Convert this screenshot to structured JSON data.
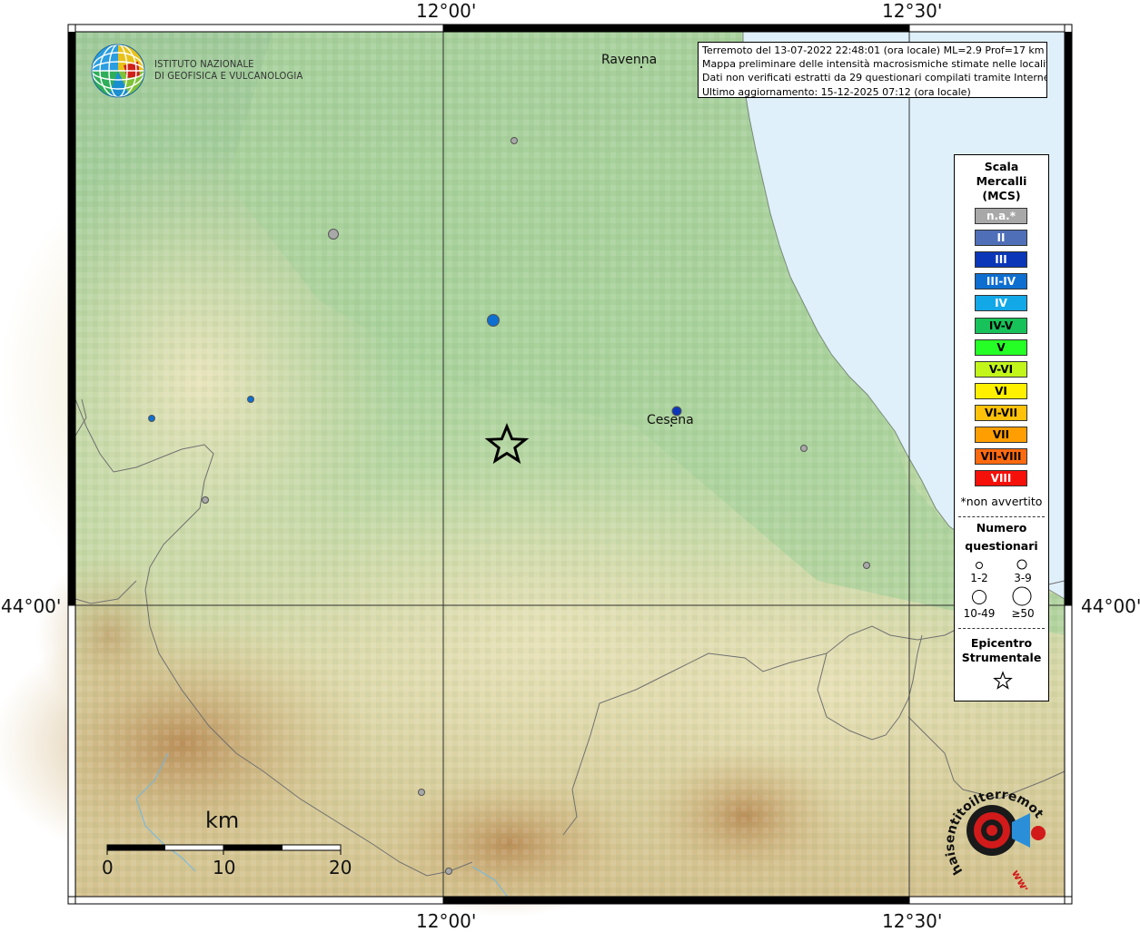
{
  "coords": {
    "top_left": "12°00'",
    "top_right": "12°30'",
    "bottom_left": "12°00'",
    "bottom_right": "12°30'",
    "lat_left": "44°00'",
    "lat_right": "44°00'"
  },
  "institute": {
    "line1": "Istituto Nazionale",
    "line2": "di Geofisica e Vulcanologia"
  },
  "info": {
    "line1": "Terremoto del 13-07-2022 22:48:01 (ora locale) ML=2.9 Prof=17 km",
    "line2": "Mappa preliminare delle intensità macrosismiche stimate nelle località",
    "line3": "Dati non verificati estratti da 29 questionari compilati tramite Internet.",
    "line4": "Ultimo aggiornamento: 15-12-2025 07:12 (ora locale)"
  },
  "places": {
    "ravenna": "Ravenna",
    "cesena": "Cesena"
  },
  "legend": {
    "title1": "Scala",
    "title2": "Mercalli",
    "title3": "(MCS)",
    "scale": [
      {
        "label": "n.a.*",
        "color": "#a8a8a8",
        "text": "#ffffff"
      },
      {
        "label": "II",
        "color": "#4f6fb8",
        "text": "#ffffff"
      },
      {
        "label": "III",
        "color": "#0b36b8",
        "text": "#ffffff"
      },
      {
        "label": "III-IV",
        "color": "#0e6fd0",
        "text": "#ffffff"
      },
      {
        "label": "IV",
        "color": "#12a8e8",
        "text": "#ffffff"
      },
      {
        "label": "IV-V",
        "color": "#18c25a",
        "text": "#000000"
      },
      {
        "label": "V",
        "color": "#26ff26",
        "text": "#000000"
      },
      {
        "label": "V-VI",
        "color": "#c2f51a",
        "text": "#000000"
      },
      {
        "label": "VI",
        "color": "#fff000",
        "text": "#000000"
      },
      {
        "label": "VI-VII",
        "color": "#ffc20a",
        "text": "#000000"
      },
      {
        "label": "VII",
        "color": "#ff9e00",
        "text": "#000000"
      },
      {
        "label": "VII-VIII",
        "color": "#ff6a10",
        "text": "#000000"
      },
      {
        "label": "VIII",
        "color": "#f5100a",
        "text": "#ffffff"
      }
    ],
    "note": "*non avvertito",
    "count_title1": "Numero",
    "count_title2": "questionari",
    "count_1": "1-2",
    "count_2": "3-9",
    "count_3": "10-49",
    "count_4": "≥50",
    "epi_title1": "Epicentro",
    "epi_title2": "Strumentale"
  },
  "scale_bar": {
    "unit": "km",
    "t0": "0",
    "t1": "10",
    "t2": "20"
  },
  "watermark": {
    "text": "haisentitoilterremoto.it",
    "url": "www."
  },
  "colors": {
    "sea": "#dff0fb",
    "plain": "#a6cf9a",
    "hills": "#d9d5a6",
    "mountains": "#c8a672",
    "grid": "#333333"
  }
}
